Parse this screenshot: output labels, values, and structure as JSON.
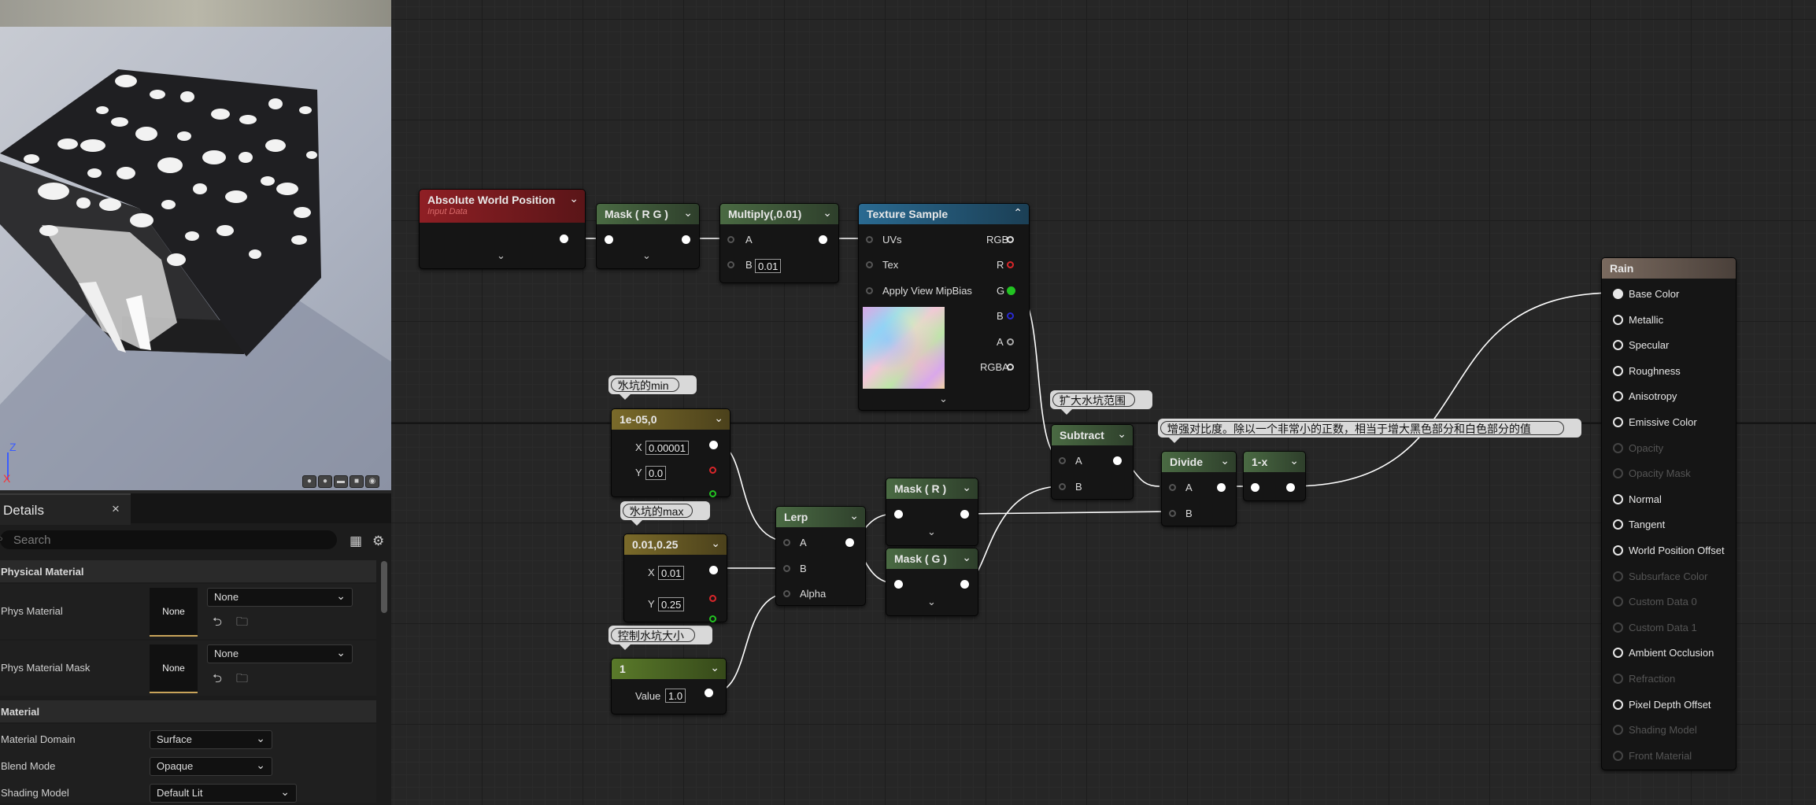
{
  "viewport": {
    "axis_z": "Z",
    "axis_x": "X",
    "buttons": [
      "sphere-preview-icon",
      "cylinder-preview-icon",
      "plane-preview-icon",
      "cube-preview-icon",
      "mesh-preview-icon"
    ]
  },
  "details": {
    "tab_title": "Details",
    "close": "×",
    "search_placeholder": "Search",
    "sections": {
      "physical_material": "Physical Material",
      "material": "Material"
    },
    "properties": {
      "phys_material": {
        "label": "Phys Material",
        "thumb": "None",
        "value": "None"
      },
      "phys_material_mask": {
        "label": "Phys Material Mask",
        "thumb": "None",
        "value": "None"
      },
      "material_domain": {
        "label": "Material Domain",
        "value": "Surface"
      },
      "blend_mode": {
        "label": "Blend Mode",
        "value": "Opaque"
      },
      "shading_model": {
        "label": "Shading Model",
        "value": "Default Lit"
      }
    }
  },
  "nodes": {
    "abs_world_pos": {
      "title": "Absolute World Position",
      "subtitle": "Input Data",
      "color": "#8f1f24"
    },
    "mask_rg": {
      "title": "Mask ( R G )",
      "color": "#4a6a43"
    },
    "multiply": {
      "title": "Multiply(,0.01)",
      "pin_a": "A",
      "pin_b": "B",
      "b_value": "0.01",
      "color": "#4a6a43"
    },
    "texture_sample": {
      "title": "Texture Sample",
      "color": "#2a6a91",
      "inputs": [
        "UVs",
        "Tex",
        "Apply View MipBias"
      ],
      "outputs": [
        "RGB",
        "R",
        "G",
        "B",
        "A",
        "RGBA"
      ]
    },
    "c_min": {
      "title": "1e-05,0",
      "x_label": "X",
      "x_value": "0.00001",
      "y_label": "Y",
      "y_value": "0.0",
      "color": "#7a6a2a"
    },
    "c_max": {
      "title": "0.01,0.25",
      "x_label": "X",
      "x_value": "0.01",
      "y_label": "Y",
      "y_value": "0.25",
      "color": "#7a6a2a"
    },
    "c_one": {
      "title": "1",
      "value_label": "Value",
      "value": "1.0",
      "color": "#5a7a2a"
    },
    "lerp": {
      "title": "Lerp",
      "pin_a": "A",
      "pin_b": "B",
      "pin_alpha": "Alpha",
      "color": "#4a6a43"
    },
    "mask_r": {
      "title": "Mask ( R )",
      "color": "#4a6a43"
    },
    "mask_g": {
      "title": "Mask ( G )",
      "color": "#4a6a43"
    },
    "subtract": {
      "title": "Subtract",
      "pin_a": "A",
      "pin_b": "B",
      "color": "#4a6a43"
    },
    "divide": {
      "title": "Divide",
      "pin_a": "A",
      "pin_b": "B",
      "color": "#4a6a43"
    },
    "one_minus": {
      "title": "1-x",
      "color": "#4a6a43"
    },
    "rain": {
      "title": "Rain",
      "pins": [
        {
          "label": "Base Color",
          "enabled": true,
          "connected": true
        },
        {
          "label": "Metallic",
          "enabled": true
        },
        {
          "label": "Specular",
          "enabled": true
        },
        {
          "label": "Roughness",
          "enabled": true
        },
        {
          "label": "Anisotropy",
          "enabled": true
        },
        {
          "label": "Emissive Color",
          "enabled": true
        },
        {
          "label": "Opacity",
          "enabled": false
        },
        {
          "label": "Opacity Mask",
          "enabled": false
        },
        {
          "label": "Normal",
          "enabled": true
        },
        {
          "label": "Tangent",
          "enabled": true
        },
        {
          "label": "World Position Offset",
          "enabled": true
        },
        {
          "label": "Subsurface Color",
          "enabled": false
        },
        {
          "label": "Custom Data 0",
          "enabled": false
        },
        {
          "label": "Custom Data 1",
          "enabled": false
        },
        {
          "label": "Ambient Occlusion",
          "enabled": true
        },
        {
          "label": "Refraction",
          "enabled": false
        },
        {
          "label": "Pixel Depth Offset",
          "enabled": true
        },
        {
          "label": "Shading Model",
          "enabled": false
        },
        {
          "label": "Front Material",
          "enabled": false
        }
      ]
    }
  },
  "comments": {
    "min": "水坑的min",
    "max": "水坑的max",
    "size": "控制水坑大小",
    "expand": "扩大水坑范围",
    "contrast": "增强对比度。除以一个非常小的正数，相当于增大黑色部分和白色部分的值"
  },
  "colors": {
    "accent_green": "#22c322",
    "accent_red": "#d9262a",
    "accent_blue": "#2a2ad0",
    "graph_bg": "#262626"
  }
}
